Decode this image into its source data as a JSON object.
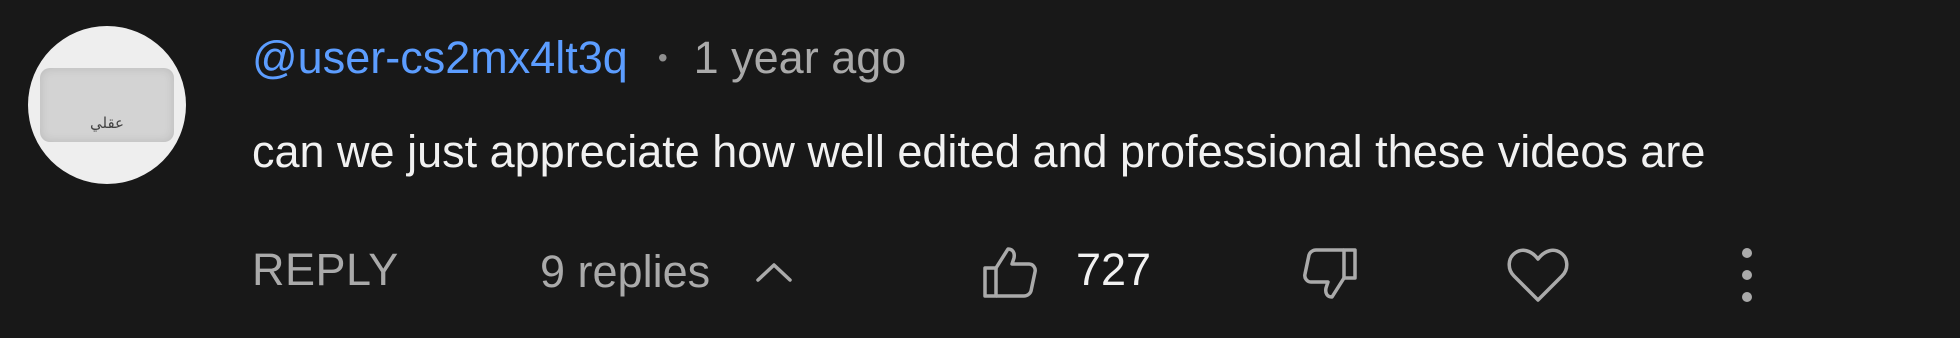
{
  "comment": {
    "avatar_text": "عقلي",
    "author": "@user-cs2mx4lt3q",
    "separator": "•",
    "time": "1 year ago",
    "text": "can we just appreciate how well edited and professional these videos are"
  },
  "actions": {
    "reply_label": "REPLY",
    "replies_label": "9 replies",
    "like_count": "727",
    "icons": {
      "replies_toggle": "chevron-up-icon",
      "like": "thumbs-up-icon",
      "dislike": "thumbs-down-icon",
      "heart": "heart-icon",
      "more": "more-vertical-icon"
    }
  },
  "colors": {
    "background": "#181818",
    "author": "#5c9dff",
    "secondary_text": "#aaaaaa",
    "primary_text": "#f1f1f1"
  }
}
